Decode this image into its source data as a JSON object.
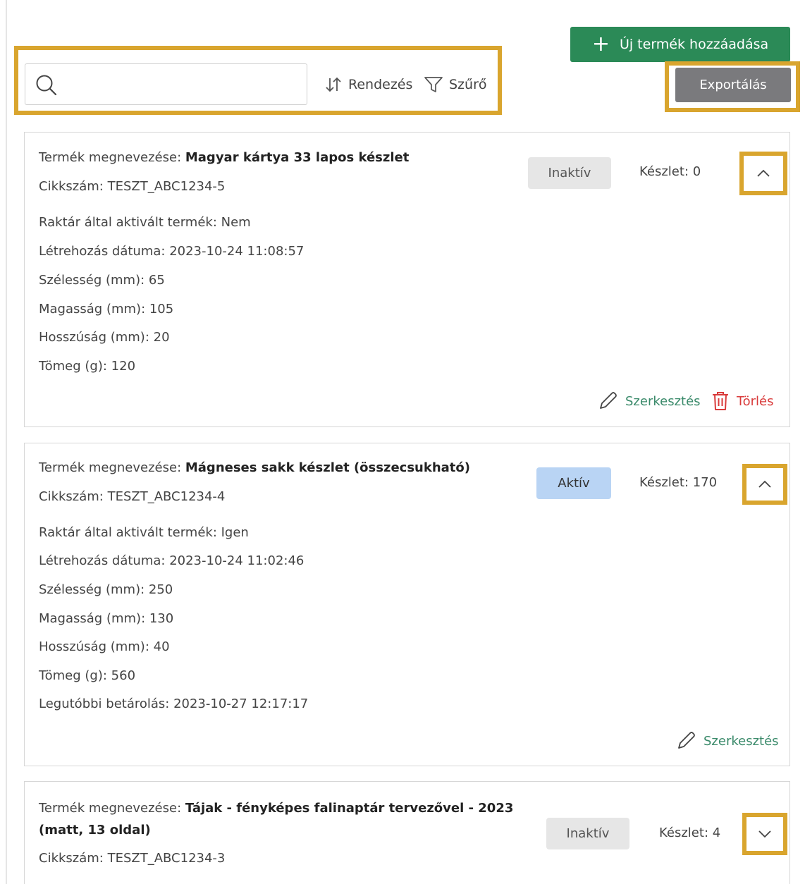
{
  "toolbar": {
    "search_placeholder": "",
    "sort_label": "Rendezés",
    "filter_label": "Szűrő",
    "add_label": "Új termék hozzáadása",
    "export_label": "Exportálás"
  },
  "colors": {
    "add_button": "#2b8a57",
    "export_button": "#7a7a7d",
    "highlight": "#d9a52e",
    "active_badge": "#b9d4f4",
    "inactive_badge": "#e6e6e6",
    "edit": "#3a8a6a",
    "delete": "#d93b3b"
  },
  "icons": [
    "search-icon",
    "sort-icon",
    "filter-icon",
    "plus-icon",
    "chevron-up-icon",
    "chevron-down-icon",
    "pencil-icon",
    "trash-icon"
  ],
  "products": [
    {
      "name_label": "Termék megnevezése:",
      "name": "Magyar kártya 33 lapos készlet",
      "sku": "Cikkszám: TESZT_ABC1234-5",
      "status": "Inaktív",
      "stock": "Készlet: 0",
      "details": [
        "Raktár által aktivált termék: Nem",
        "Létrehozás dátuma: 2023-10-24 11:08:57",
        "Szélesség (mm): 65",
        "Magasság (mm): 105",
        "Hosszúság (mm): 20",
        "Tömeg (g): 120"
      ],
      "edit_label": "Szerkesztés",
      "delete_label": "Törlés"
    },
    {
      "name_label": "Termék megnevezése:",
      "name": "Mágneses sakk készlet (összecsukható)",
      "sku": "Cikkszám: TESZT_ABC1234-4",
      "status": "Aktív",
      "stock": "Készlet: 170",
      "details": [
        "Raktár által aktivált termék: Igen",
        "Létrehozás dátuma: 2023-10-24 11:02:46",
        "Szélesség (mm): 250",
        "Magasság (mm): 130",
        "Hosszúság (mm): 40",
        "Tömeg (g): 560",
        "Legutóbbi betárolás: 2023-10-27 12:17:17"
      ],
      "edit_label": "Szerkesztés"
    },
    {
      "name_label": "Termék megnevezése:",
      "name": "Tájak - fényképes falinaptár tervezővel - 2023 (matt, 13 oldal)",
      "sku": "Cikkszám: TESZT_ABC1234-3",
      "status": "Inaktív",
      "stock": "Készlet: 4"
    }
  ]
}
